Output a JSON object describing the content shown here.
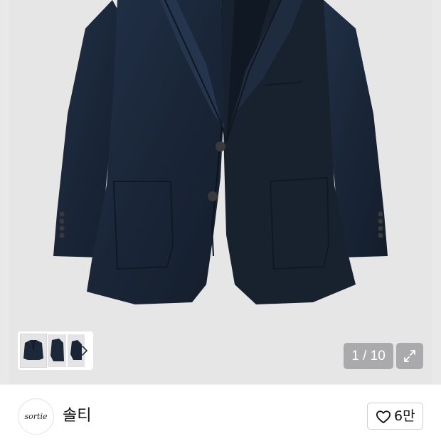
{
  "gallery": {
    "image_subject": "navy blazer jacket",
    "counter": "1 / 10",
    "thumbnail_count_visible": 3,
    "background": "#e6e6e7",
    "jacket_color": "#1b2636"
  },
  "shop": {
    "logo_text": "sortie",
    "name": "솔티"
  },
  "like": {
    "icon": "heart-outline-icon",
    "count": "6만"
  }
}
